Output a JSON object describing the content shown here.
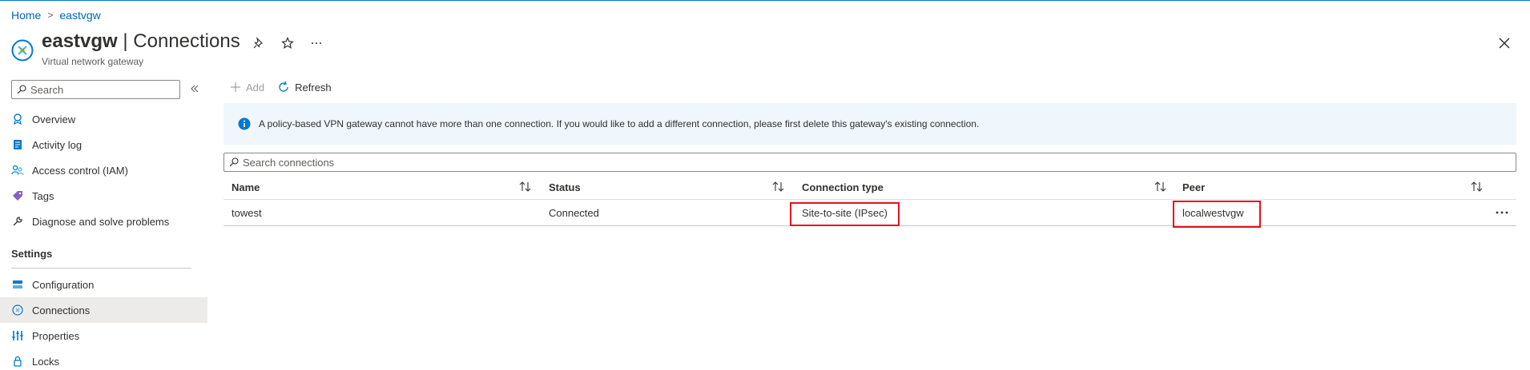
{
  "breadcrumb": {
    "home": "Home",
    "resource": "eastvgw",
    "separator": ">"
  },
  "header": {
    "resource_name": "eastvgw",
    "page_name": "| Connections",
    "subtitle": "Virtual network gateway",
    "icons": [
      "pin-icon",
      "star-icon",
      "more-icon",
      "close-icon"
    ]
  },
  "sidebar": {
    "search_placeholder": "Search",
    "items": [
      {
        "label": "Overview",
        "icon": "overview-icon"
      },
      {
        "label": "Activity log",
        "icon": "activity-log-icon"
      },
      {
        "label": "Access control (IAM)",
        "icon": "iam-icon"
      },
      {
        "label": "Tags",
        "icon": "tag-icon"
      },
      {
        "label": "Diagnose and solve problems",
        "icon": "wrench-icon"
      }
    ],
    "section": "Settings",
    "settings_items": [
      {
        "label": "Configuration",
        "icon": "configuration-icon"
      },
      {
        "label": "Connections",
        "icon": "connections-icon",
        "active": true
      },
      {
        "label": "Properties",
        "icon": "properties-icon"
      },
      {
        "label": "Locks",
        "icon": "lock-icon"
      }
    ]
  },
  "toolbar": {
    "add_label": "Add",
    "refresh_label": "Refresh"
  },
  "info": {
    "message": "A policy-based VPN gateway cannot have more than one connection. If you would like to add a different connection, please first delete this gateway's existing connection."
  },
  "table": {
    "search_placeholder": "Search connections",
    "columns": [
      "Name",
      "Status",
      "Connection type",
      "Peer"
    ],
    "rows": [
      {
        "name": "towest",
        "status": "Connected",
        "connection_type": "Site-to-site (IPsec)",
        "peer": "localwestvgw"
      }
    ]
  },
  "colors": {
    "accent": "#0078d4",
    "highlight": "#e81123",
    "info_bg": "#eff6fc",
    "active_nav": "#edebe9"
  }
}
